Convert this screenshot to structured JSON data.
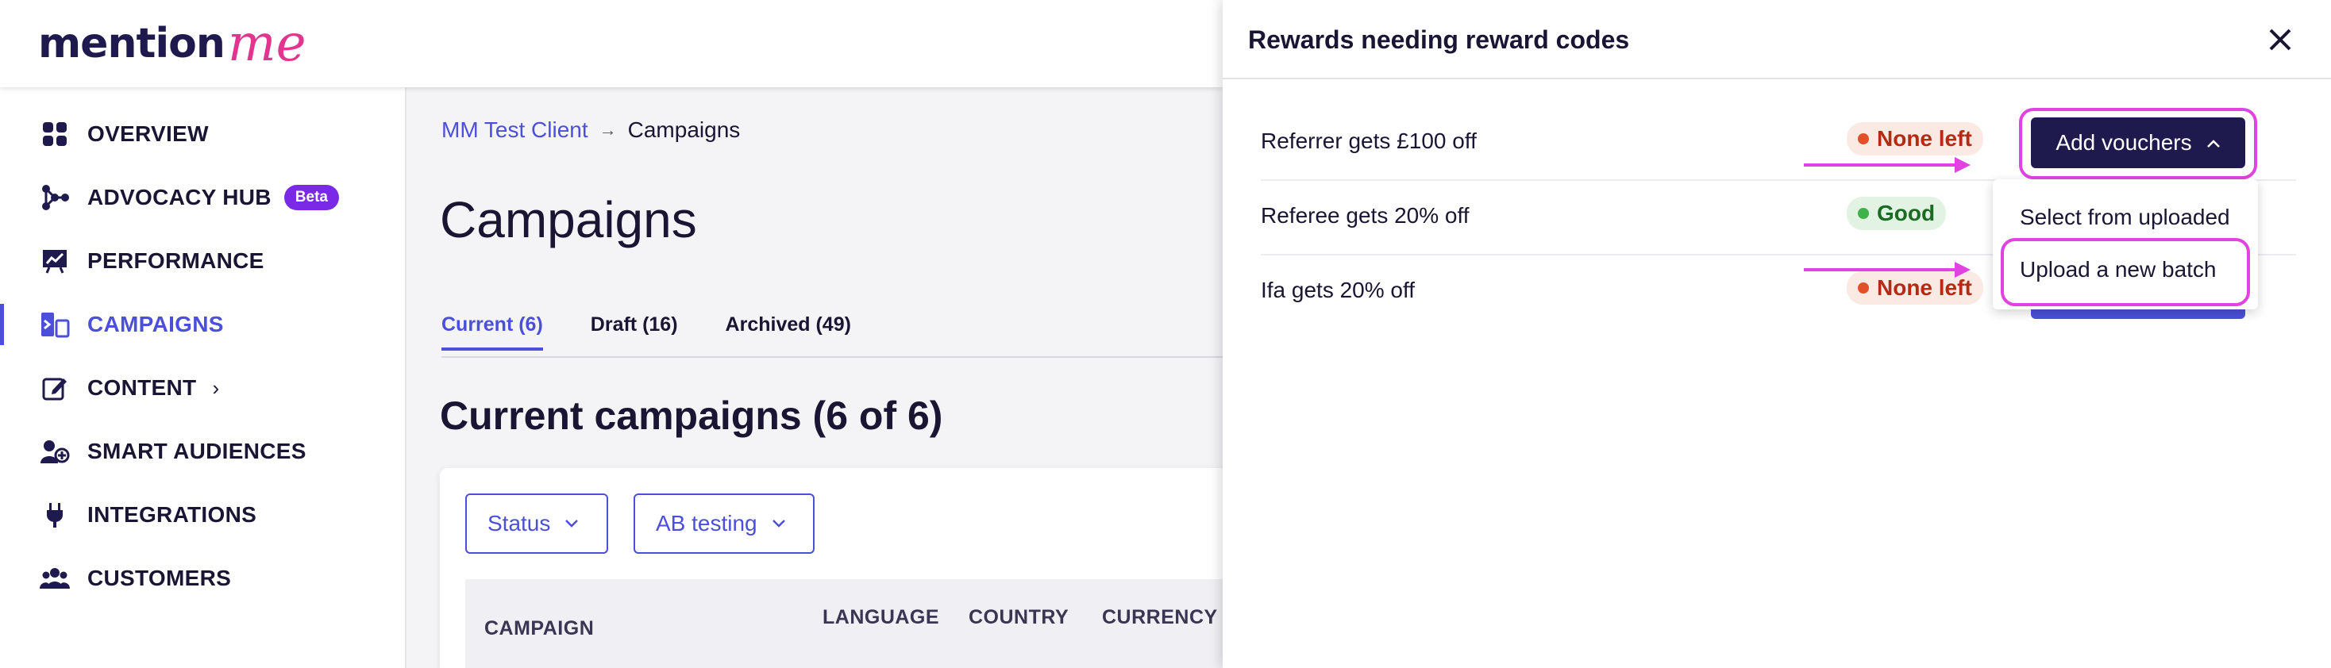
{
  "logo": {
    "part1": "mention",
    "part2": "me"
  },
  "sidebar": {
    "items": [
      {
        "label": "OVERVIEW",
        "icon": "grid-icon"
      },
      {
        "label": "ADVOCACY HUB",
        "icon": "network-icon",
        "badge": "Beta"
      },
      {
        "label": "PERFORMANCE",
        "icon": "chart-board-icon"
      },
      {
        "label": "CAMPAIGNS",
        "icon": "campaigns-icon",
        "active": true
      },
      {
        "label": "CONTENT",
        "icon": "edit-icon",
        "chevron": "›"
      },
      {
        "label": "SMART AUDIENCES",
        "icon": "audience-icon"
      },
      {
        "label": "INTEGRATIONS",
        "icon": "plug-icon"
      },
      {
        "label": "CUSTOMERS",
        "icon": "users-icon"
      }
    ]
  },
  "breadcrumb": {
    "client": "MM Test Client",
    "separator": "→",
    "current": "Campaigns"
  },
  "main": {
    "title": "Campaigns",
    "tabs": [
      {
        "label": "Current (6)",
        "active": true
      },
      {
        "label": "Draft (16)"
      },
      {
        "label": "Archived (49)"
      }
    ],
    "section_title": "Current campaigns (6 of 6)",
    "filters": [
      {
        "label": "Status"
      },
      {
        "label": "AB testing"
      }
    ],
    "table_headers": [
      "CAMPAIGN",
      "LANGUAGE",
      "COUNTRY",
      "CURRENCY"
    ]
  },
  "drawer": {
    "title": "Rewards needing reward codes",
    "close_label": "×",
    "rows": [
      {
        "name": "Referrer gets £100 off",
        "status": "None left",
        "status_type": "bad"
      },
      {
        "name": "Referee gets 20% off",
        "status": "Good",
        "status_type": "good"
      },
      {
        "name": "Ifa gets 20% off",
        "status": "None left",
        "status_type": "bad"
      }
    ],
    "add_button_label": "Add vouchers",
    "dropdown": [
      "Select from uploaded",
      "Upload a new batch"
    ]
  },
  "colors": {
    "brand_navy": "#1f1a4d",
    "brand_pink": "#e0368f",
    "accent_blue": "#4b4fd9",
    "highlight_magenta": "#e043e0"
  }
}
